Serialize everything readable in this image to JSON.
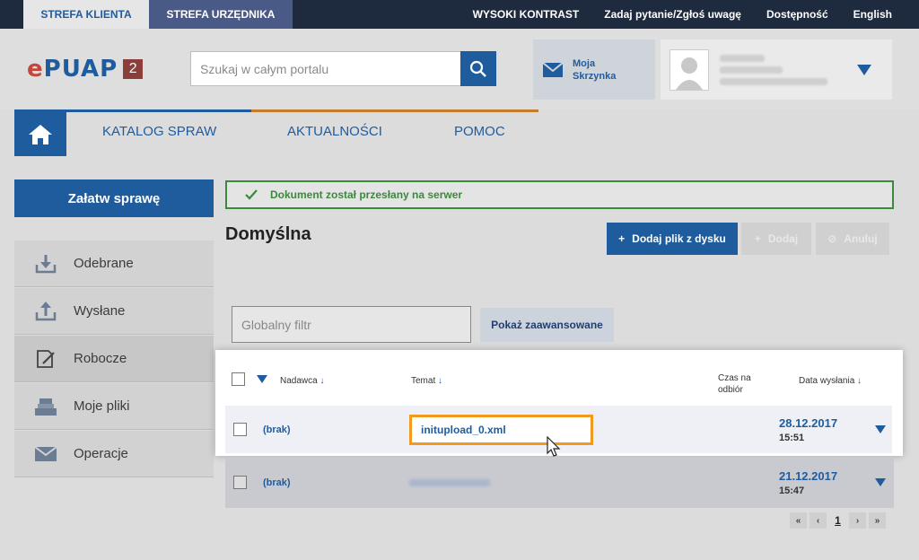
{
  "topbar": {
    "tab_client": "STREFA KLIENTA",
    "tab_official": "STREFA URZĘDNIKA",
    "links": [
      "WYSOKI KONTRAST",
      "Zadaj pytanie/Zgłoś uwagę",
      "Dostępność",
      "English"
    ]
  },
  "header": {
    "logo": "ePUAP",
    "logo_badge": "2",
    "search_placeholder": "Szukaj w całym portalu",
    "mailbox_label_1": "Moja",
    "mailbox_label_2": "Skrzynka"
  },
  "nav": {
    "items": [
      "KATALOG SPRAW",
      "AKTUALNOŚCI",
      "POMOC"
    ]
  },
  "sidebar": {
    "cta": "Załatw sprawę",
    "items": [
      {
        "label": "Odebrane",
        "icon": "inbox-download-icon"
      },
      {
        "label": "Wysłane",
        "icon": "outbox-upload-icon"
      },
      {
        "label": "Robocze",
        "icon": "draft-edit-icon"
      },
      {
        "label": "Moje pliki",
        "icon": "files-tray-icon"
      },
      {
        "label": "Operacje",
        "icon": "envelope-icon"
      }
    ]
  },
  "main": {
    "alert": "Dokument został przesłany na serwer",
    "title": "Domyślna",
    "btn_add_file": "Dodaj plik z dysku",
    "btn_add": "Dodaj",
    "btn_cancel": "Anuluj",
    "filter_placeholder": "Globalny filtr",
    "btn_advanced": "Pokaż zaawansowane"
  },
  "table": {
    "col_sender": "Nadawca",
    "col_subject": "Temat",
    "col_time_1": "Czas na",
    "col_time_2": "odbiór",
    "col_date": "Data wysłania",
    "rows": [
      {
        "sender": "(brak)",
        "subject": "initupload_0.xml",
        "date": "28.12.2017",
        "time": "15:51"
      },
      {
        "sender": "(brak)",
        "subject": "",
        "date": "21.12.2017",
        "time": "15:47"
      }
    ]
  },
  "pager": {
    "first": "«",
    "prev": "‹",
    "page": "1",
    "next": "›",
    "last": "»"
  },
  "colors": {
    "primary": "#1f5c9e",
    "success": "#3b8a3b",
    "highlight": "#f29a1f",
    "topbar": "#1e2a3e"
  }
}
